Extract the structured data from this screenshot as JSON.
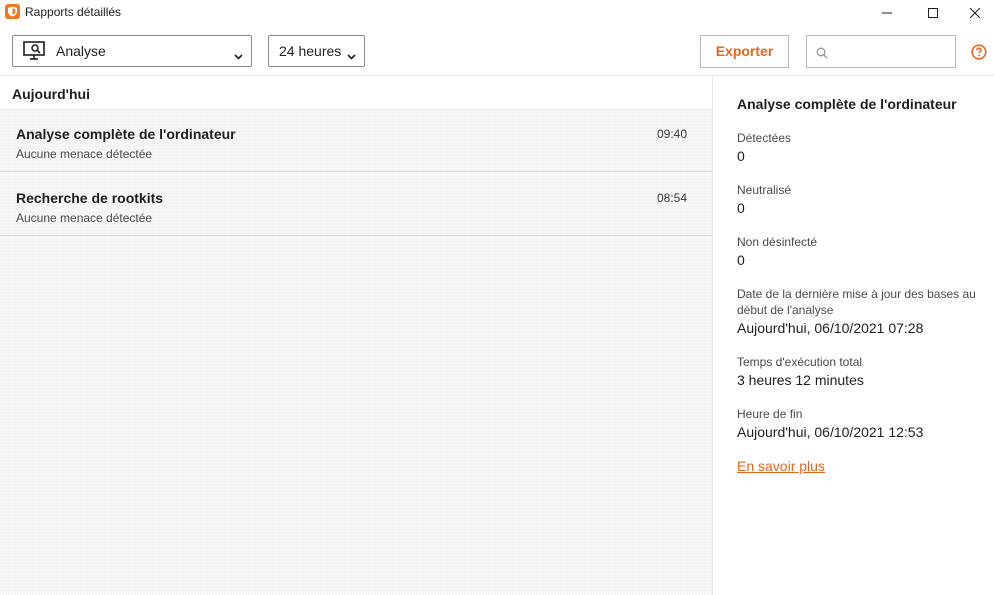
{
  "window": {
    "title": "Rapports détaillés"
  },
  "toolbar": {
    "type_select": "Analyse",
    "period_select": "24 heures",
    "export_label": "Exporter",
    "search_value": ""
  },
  "list": {
    "section_title": "Aujourd'hui",
    "items": [
      {
        "title": "Analyse complète de l'ordinateur",
        "subtitle": "Aucune menace détectée",
        "time": "09:40"
      },
      {
        "title": "Recherche de rootkits",
        "subtitle": "Aucune menace détectée",
        "time": "08:54"
      }
    ]
  },
  "details": {
    "title": "Analyse complète de l'ordinateur",
    "fields": [
      {
        "label": "Détectées",
        "value": "0"
      },
      {
        "label": "Neutralisé",
        "value": "0"
      },
      {
        "label": "Non désinfecté",
        "value": "0"
      },
      {
        "label": "Date de la dernière mise à jour des bases au début de l'analyse",
        "value": "Aujourd'hui, 06/10/2021 07:28"
      },
      {
        "label": "Temps d'exécution total",
        "value": "3 heures 12 minutes"
      },
      {
        "label": "Heure de fin",
        "value": "Aujourd'hui, 06/10/2021 12:53"
      }
    ],
    "link": "En savoir plus"
  },
  "colors": {
    "accent": "#e8651a",
    "list_background": "#f3f3f3"
  },
  "icons": {
    "app": "shield-icon",
    "type_select": "monitor-search-icon",
    "search": "search-icon",
    "help": "help-icon"
  }
}
